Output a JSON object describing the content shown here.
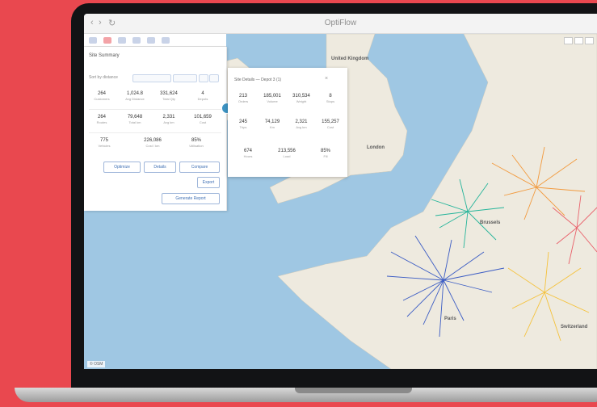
{
  "window": {
    "title": "OptiFlow"
  },
  "nav": {
    "back": "‹",
    "forward": "›",
    "reload": "↻"
  },
  "map_labels": {
    "uk": "United Kingdom",
    "london": "London",
    "paris": "Paris",
    "bruxelles": "Brussels",
    "switzerland": "Switzerland"
  },
  "panel": {
    "title": "Site Summary",
    "row_label": "Sort by distance",
    "stats": [
      {
        "value": "264",
        "label": "Customers"
      },
      {
        "value": "1,024.8",
        "label": "Avg Distance"
      },
      {
        "value": "331,624",
        "label": "Total Qty"
      },
      {
        "value": "4",
        "label": "Depots"
      },
      {
        "value": "264",
        "label": "Routes"
      },
      {
        "value": "79,648",
        "label": "Total km"
      },
      {
        "value": "2,331",
        "label": "Avg km"
      },
      {
        "value": "101,659",
        "label": "Cost"
      },
      {
        "value": "775",
        "label": "Vehicles"
      },
      {
        "value": "226,086",
        "label": "Cost / km"
      },
      {
        "value": "85%",
        "label": "Utilisation"
      }
    ],
    "buttons": {
      "optimize": "Optimize",
      "details": "Details",
      "compare": "Compare",
      "export": "Export",
      "generate": "Generate Report"
    }
  },
  "popup": {
    "title": "Site Details — Depot 3 (1)",
    "close": "×",
    "stats": [
      {
        "value": "213",
        "label": "Orders"
      },
      {
        "value": "185,001",
        "label": "Volume"
      },
      {
        "value": "310,534",
        "label": "Weight"
      },
      {
        "value": "8",
        "label": "Stops"
      },
      {
        "value": "245",
        "label": "Trips"
      },
      {
        "value": "74,129",
        "label": "Km"
      },
      {
        "value": "2,321",
        "label": "Avg km"
      },
      {
        "value": "155,257",
        "label": "Cost"
      },
      {
        "value": "674",
        "label": "Hours"
      },
      {
        "value": "213,556",
        "label": "Load"
      },
      {
        "value": "85%",
        "label": "Fill"
      }
    ]
  },
  "attribution": "© OSM",
  "colors": {
    "background": "#e9484f",
    "route_blue": "#3b5cc4",
    "route_teal": "#24b49a",
    "route_orange": "#f29a3e",
    "route_yellow": "#f5c23b",
    "route_red": "#e9606a"
  }
}
